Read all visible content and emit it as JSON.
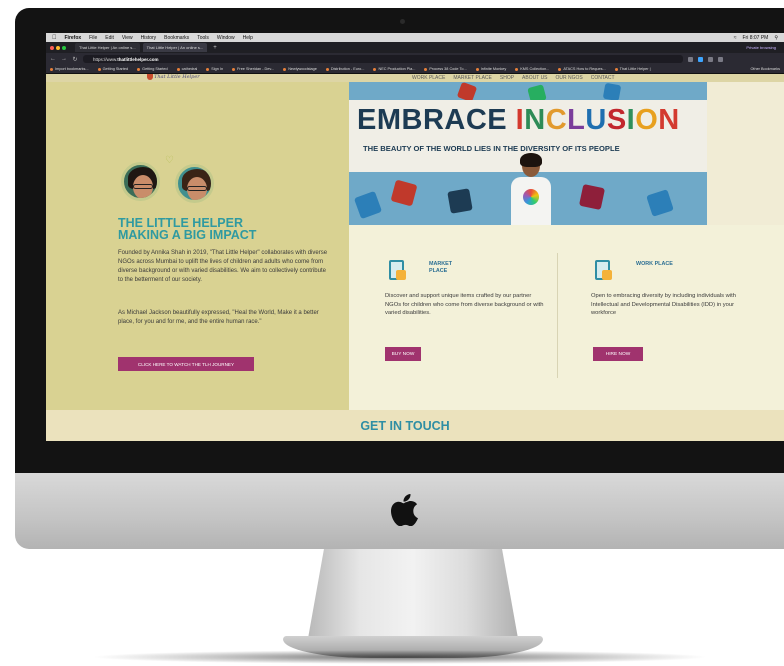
{
  "menubar": {
    "items": [
      "Firefox",
      "File",
      "Edit",
      "View",
      "History",
      "Bookmarks",
      "Tools",
      "Window",
      "Help"
    ],
    "clock": "Fri 8:07 PM"
  },
  "browser": {
    "tabs": [
      {
        "label": "That Little Helper | An online s...",
        "active": false
      },
      {
        "label": "That Little Helper | An online s...",
        "active": true
      }
    ],
    "private_label": "Private browsing",
    "url_prefix": "https://www.",
    "url_domain": "thatlittlehelper.com",
    "bookmarks": [
      "Import bookmarks...",
      "Getting Started",
      "Getting Started",
      "cathedral",
      "Sign In",
      "Free Sheridan - Dev...",
      "Newlywoodstage",
      "Distribution - Euro...",
      "NEC Production Pla...",
      "Process 38 Code To...",
      "Infinite Monkey",
      "KMS Collection...",
      "ATACS How to Reques...",
      "That Little Helper |"
    ],
    "other_bookmarks": "Other Bookmarks"
  },
  "site": {
    "logo_text": "That Little Helper",
    "nav": [
      "WORK PLACE",
      "MARKET PLACE",
      "SHOP",
      "ABOUT US",
      "OUR NGOS",
      "CONTACT"
    ],
    "headline": "THE LITTLE HELPER\nMAKING A BIG IMPACT",
    "para1": "Founded by Annika Shah in 2019, \"That Little Helper\" collaborates with diverse NGOs across Mumbai to uplift the lives of children and adults who come from diverse background or with varied disabilities. We aim to collectively contribute to the betterment of our society.",
    "para2": "As Michael Jackson beautifully expressed, \"Heal the World, Make it a better place, for you and for me, and the entire human race.\"",
    "video_cta": "CLICK HERE TO WATCH THE TLH JOURNEY",
    "banner": {
      "word1": "EMBRACE ",
      "word2_letters": [
        "I",
        "N",
        "C",
        "L",
        "U",
        "S",
        "I",
        "O",
        "N"
      ],
      "subtitle": "THE BEAUTY OF THE WORLD LIES IN THE DIVERSITY OF ITS PEOPLE"
    },
    "cards": [
      {
        "title": "MARKET PLACE",
        "body": "Discover and support unique items crafted by our partner NGOs for children who come from diverse background or with varied disabilities.",
        "button": "BUY NOW"
      },
      {
        "title": "WORK PLACE",
        "body": "Open to embracing diversity by including individuals with Intellectual and Developmental Disabilities (IDD) in your workforce",
        "button": "HIRE NOW"
      }
    ],
    "contact_heading": "GET IN TOUCH"
  },
  "colors": {
    "accent_teal": "#2f9aa1",
    "button_magenta": "#a0336e",
    "left_panel": "#d9d292",
    "cards_bg": "#f3f1d9"
  }
}
